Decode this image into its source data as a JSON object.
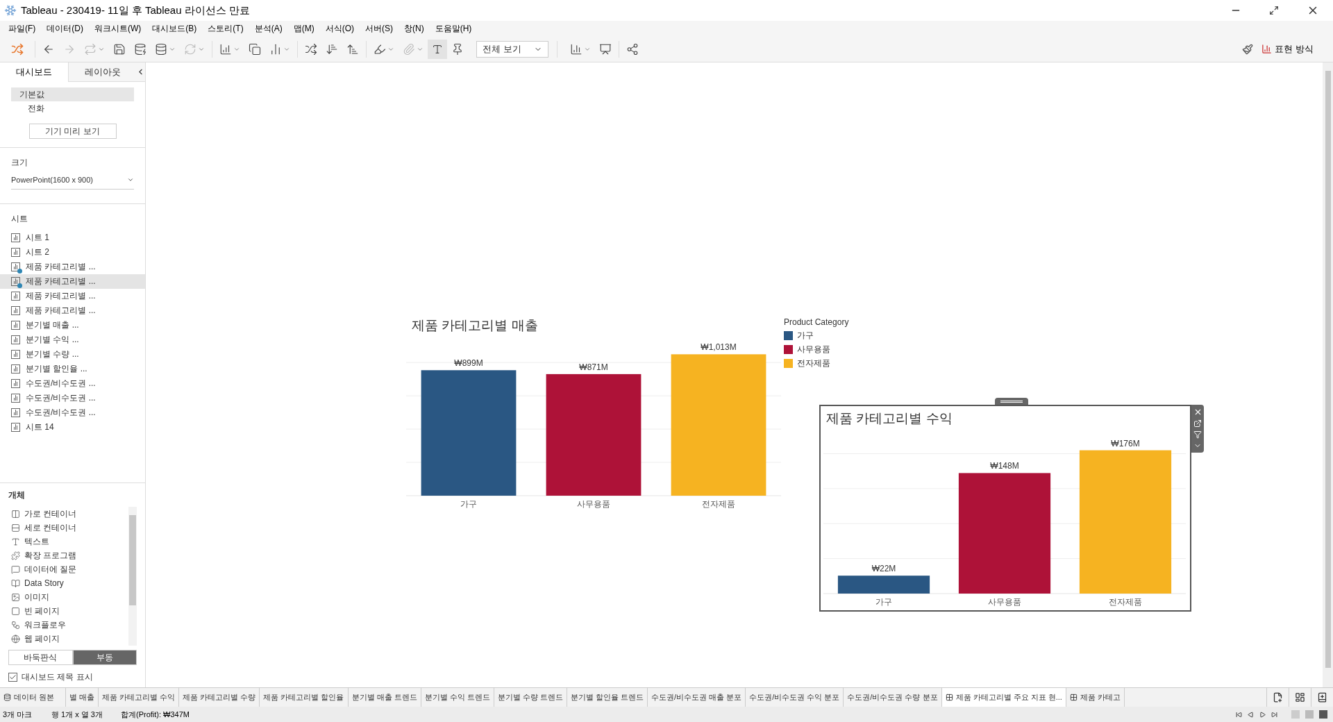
{
  "window": {
    "title": "Tableau - 230419- 11일 후 Tableau 라이선스 만료"
  },
  "menu": [
    "파일(F)",
    "데이터(D)",
    "워크시트(W)",
    "대시보드(B)",
    "스토리(T)",
    "분석(A)",
    "맵(M)",
    "서식(O)",
    "서버(S)",
    "창(N)",
    "도움말(H)"
  ],
  "toolbar": {
    "fit": "전체 보기",
    "presentation": "표현 방식"
  },
  "sidebar": {
    "tabs": [
      {
        "label": "대시보드",
        "selected": true
      },
      {
        "label": "레이아웃",
        "selected": false
      }
    ],
    "devices": [
      {
        "label": "기본값",
        "selected": true
      },
      {
        "label": "전화",
        "selected": false
      }
    ],
    "preview_button": "기기 미리 보기",
    "size_heading": "크기",
    "size_value": "PowerPoint(1600 x 900)",
    "sheets_heading": "시트",
    "sheets": [
      {
        "label": "시트 1",
        "in_use": false,
        "selected": false
      },
      {
        "label": "시트 2",
        "in_use": false,
        "selected": false
      },
      {
        "label": "제품 카테고리별 ...",
        "in_use": true,
        "selected": false
      },
      {
        "label": "제품 카테고리별 ...",
        "in_use": true,
        "selected": true
      },
      {
        "label": "제품 카테고리별 ...",
        "in_use": false,
        "selected": false
      },
      {
        "label": "제품 카테고리별 ...",
        "in_use": false,
        "selected": false
      },
      {
        "label": "분기별 매출 ...",
        "in_use": false,
        "selected": false
      },
      {
        "label": "분기별 수익 ...",
        "in_use": false,
        "selected": false
      },
      {
        "label": "분기별 수량 ...",
        "in_use": false,
        "selected": false
      },
      {
        "label": "분기별 할인율 ...",
        "in_use": false,
        "selected": false
      },
      {
        "label": "수도권/비수도권 ...",
        "in_use": false,
        "selected": false
      },
      {
        "label": "수도권/비수도권 ...",
        "in_use": false,
        "selected": false
      },
      {
        "label": "수도권/비수도권 ...",
        "in_use": false,
        "selected": false
      },
      {
        "label": "시트 14",
        "in_use": false,
        "selected": false
      }
    ],
    "objects_heading": "개체",
    "objects": [
      {
        "label": "가로 컨테이너",
        "kind": "horizontal"
      },
      {
        "label": "세로 컨테이너",
        "kind": "vertical"
      },
      {
        "label": "텍스트",
        "kind": "text"
      },
      {
        "label": "확장 프로그램",
        "kind": "extension"
      },
      {
        "label": "데이터에 질문",
        "kind": "ask"
      },
      {
        "label": "Data Story",
        "kind": "story"
      },
      {
        "label": "이미지",
        "kind": "image"
      },
      {
        "label": "빈 페이지",
        "kind": "blank"
      },
      {
        "label": "워크플로우",
        "kind": "workflow"
      },
      {
        "label": "웹 페이지",
        "kind": "web"
      }
    ],
    "layout_modes": [
      {
        "label": "바둑판식",
        "selected": false
      },
      {
        "label": "부동",
        "selected": true
      }
    ],
    "show_title": {
      "label": "대시보드 제목 표시",
      "checked": true
    }
  },
  "charts": [
    {
      "title": "제품 카테고리별 매출",
      "selected": false,
      "chart_data": {
        "type": "bar",
        "categories": [
          "가구",
          "사무용품",
          "전자제품"
        ],
        "series": [
          {
            "color": "#2a5783",
            "values": [
              899,
              null,
              null
            ],
            "value_labels": [
              "₩899M",
              null,
              null
            ]
          },
          {
            "color": "#ae1238",
            "values": [
              null,
              871,
              null
            ],
            "value_labels": [
              null,
              "₩871M",
              null
            ]
          },
          {
            "color": "#f6b321",
            "values": [
              null,
              null,
              1013
            ],
            "value_labels": [
              null,
              null,
              "₩1,013M"
            ]
          }
        ],
        "data_labels": true
      },
      "legend": {
        "title": "Product Category",
        "items": [
          {
            "label": "가구",
            "color": "#2a5783"
          },
          {
            "label": "사무용품",
            "color": "#ae1238"
          },
          {
            "label": "전자제품",
            "color": "#f6b321"
          }
        ]
      }
    },
    {
      "title": "제품 카테고리별 수익",
      "selected": true,
      "chart_data": {
        "type": "bar",
        "categories": [
          "가구",
          "사무용품",
          "전자제품"
        ],
        "series": [
          {
            "color": "#2a5783",
            "values": [
              22,
              null,
              null
            ],
            "value_labels": [
              "₩22M",
              null,
              null
            ]
          },
          {
            "color": "#ae1238",
            "values": [
              null,
              148,
              null
            ],
            "value_labels": [
              null,
              "₩148M",
              null
            ]
          },
          {
            "color": "#f6b321",
            "values": [
              null,
              null,
              176
            ],
            "value_labels": [
              null,
              null,
              "₩176M"
            ]
          }
        ],
        "data_labels": true
      }
    }
  ],
  "sheet_tabs": [
    {
      "label": "데이터 원본",
      "kind": "datasource",
      "selected": false
    },
    {
      "label": "별 매출",
      "kind": "sheet",
      "selected": false
    },
    {
      "label": "제품 카테고리별 수익",
      "kind": "sheet",
      "selected": false
    },
    {
      "label": "제품 카테고리별 수량",
      "kind": "sheet",
      "selected": false
    },
    {
      "label": "제품 카테고리별 할인율",
      "kind": "sheet",
      "selected": false
    },
    {
      "label": "분기별 매출 트렌드",
      "kind": "sheet",
      "selected": false
    },
    {
      "label": "분기별 수익 트렌드",
      "kind": "sheet",
      "selected": false
    },
    {
      "label": "분기별 수량 트렌드",
      "kind": "sheet",
      "selected": false
    },
    {
      "label": "분기별 할인율 트렌드",
      "kind": "sheet",
      "selected": false
    },
    {
      "label": "수도권/비수도권 매출 분포",
      "kind": "sheet",
      "selected": false
    },
    {
      "label": "수도권/비수도권 수익 분포",
      "kind": "sheet",
      "selected": false
    },
    {
      "label": "수도권/비수도권 수량 분포",
      "kind": "sheet",
      "selected": false
    },
    {
      "label": "제품 카테고리별 주요 지표 현...",
      "kind": "dashboard",
      "selected": true
    },
    {
      "label": "제품 카테고",
      "kind": "dashboard",
      "selected": false
    }
  ],
  "status_bar": {
    "marks": "3개 마크",
    "dims": "행 1개 x 열 3개",
    "sum": "합계(Profit): ₩347M"
  }
}
